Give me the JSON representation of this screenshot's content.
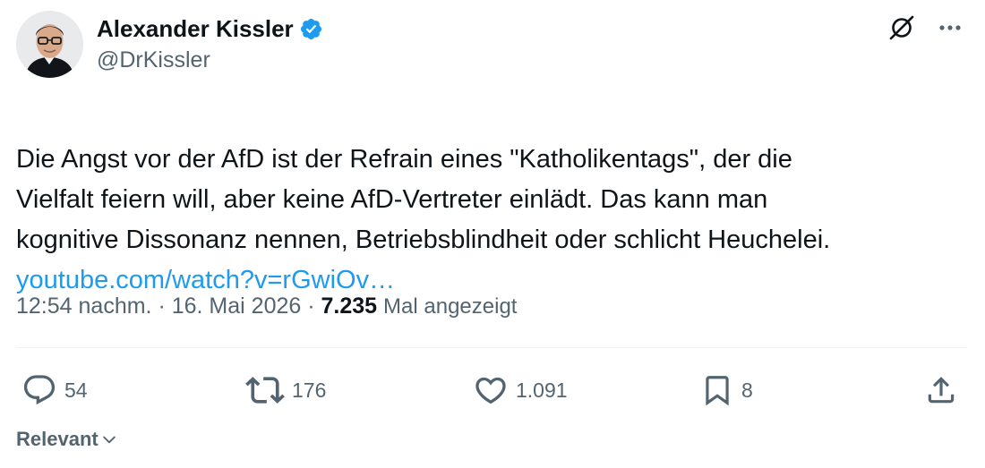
{
  "author": {
    "name": "Alexander Kissler",
    "handle": "@DrKissler",
    "verified": true
  },
  "tweet": {
    "text": "Die Angst vor der AfD ist der Refrain eines \"Katholikentags\", der die\nVielfalt feiern will, aber keine AfD-Vertreter einlädt. Das kann man\nkognitive Dissonanz nennen, Betriebsblindheit oder schlicht Heuchelei.",
    "link": "youtube.com/watch?v=rGwiOv…"
  },
  "meta": {
    "time": "12:54 nachm.",
    "separator": "·",
    "date": "16. Mai 2026",
    "views_count": "7.235",
    "views_label": "Mal angezeigt"
  },
  "actions": {
    "replies": "54",
    "reposts": "176",
    "likes": "1.091",
    "bookmarks": "8"
  },
  "sort": {
    "label": "Relevant"
  },
  "icons": {
    "top_right": [
      "grok-icon",
      "more-icon"
    ],
    "actions": [
      "reply-icon",
      "repost-icon",
      "like-icon",
      "bookmark-icon",
      "share-icon"
    ]
  },
  "colors": {
    "link": "#1d9bf0",
    "secondary_text": "#536471",
    "primary_text": "#0f1419",
    "verified_badge": "#1d9bf0"
  }
}
